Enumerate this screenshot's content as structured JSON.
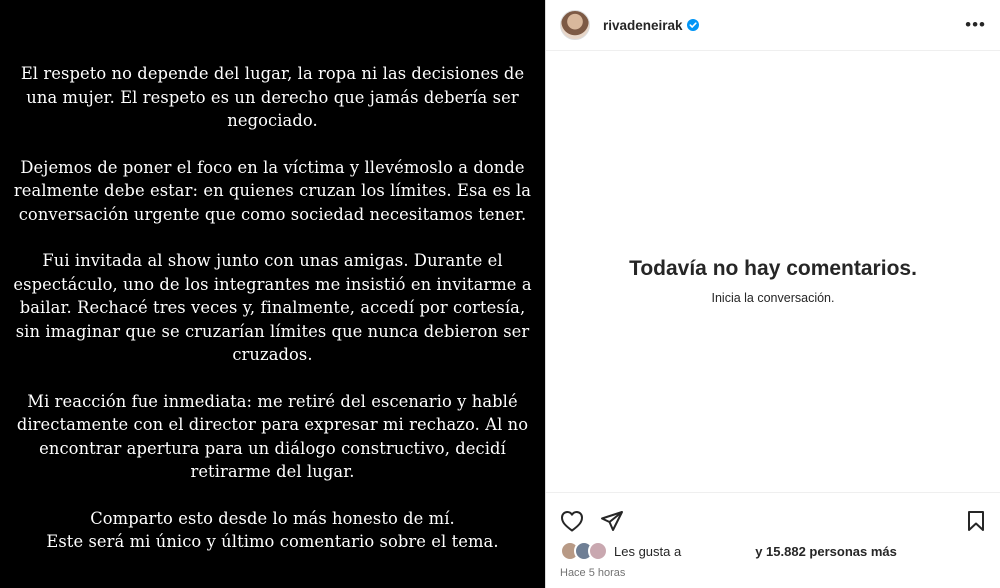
{
  "story": {
    "paragraphs": [
      "El respeto no depende del lugar, la ropa ni las decisiones de una mujer. El respeto es un derecho que jamás debería ser negociado.",
      "Dejemos de poner el foco en la víctima y llevémoslo a donde realmente debe estar: en quienes cruzan los límites. Esa es la conversación urgente que como sociedad necesitamos tener.",
      "Fui invitada al show junto con unas amigas. Durante el espectáculo, uno de los integrantes me insistió en invitarme a bailar. Rechacé tres veces y, finalmente, accedí por cortesía, sin imaginar que se cruzarían límites que nunca debieron ser cruzados.",
      "Mi reacción fue inmediata: me retiré del escenario y hablé directamente con el director para expresar mi rechazo. Al no encontrar apertura para un diálogo constructivo, decidí retirarme del lugar.",
      "Comparto esto desde lo más honesto de mí.\nEste será mi único y último comentario sobre el tema."
    ]
  },
  "post": {
    "username": "rivadeneirak",
    "verified": true,
    "more_icon": "more-horizontal-icon"
  },
  "comments": {
    "empty_title": "Todavía no hay comentarios.",
    "empty_subtitle": "Inicia la conversación."
  },
  "footer": {
    "likes_prefix": "Les gusta a",
    "likes_suffix": "y 15.882 personas más",
    "timestamp": "Hace 5 horas"
  },
  "colors": {
    "story_bg": "#000000",
    "verified_blue": "#0095f6",
    "text": "#262626",
    "muted": "#737373"
  }
}
